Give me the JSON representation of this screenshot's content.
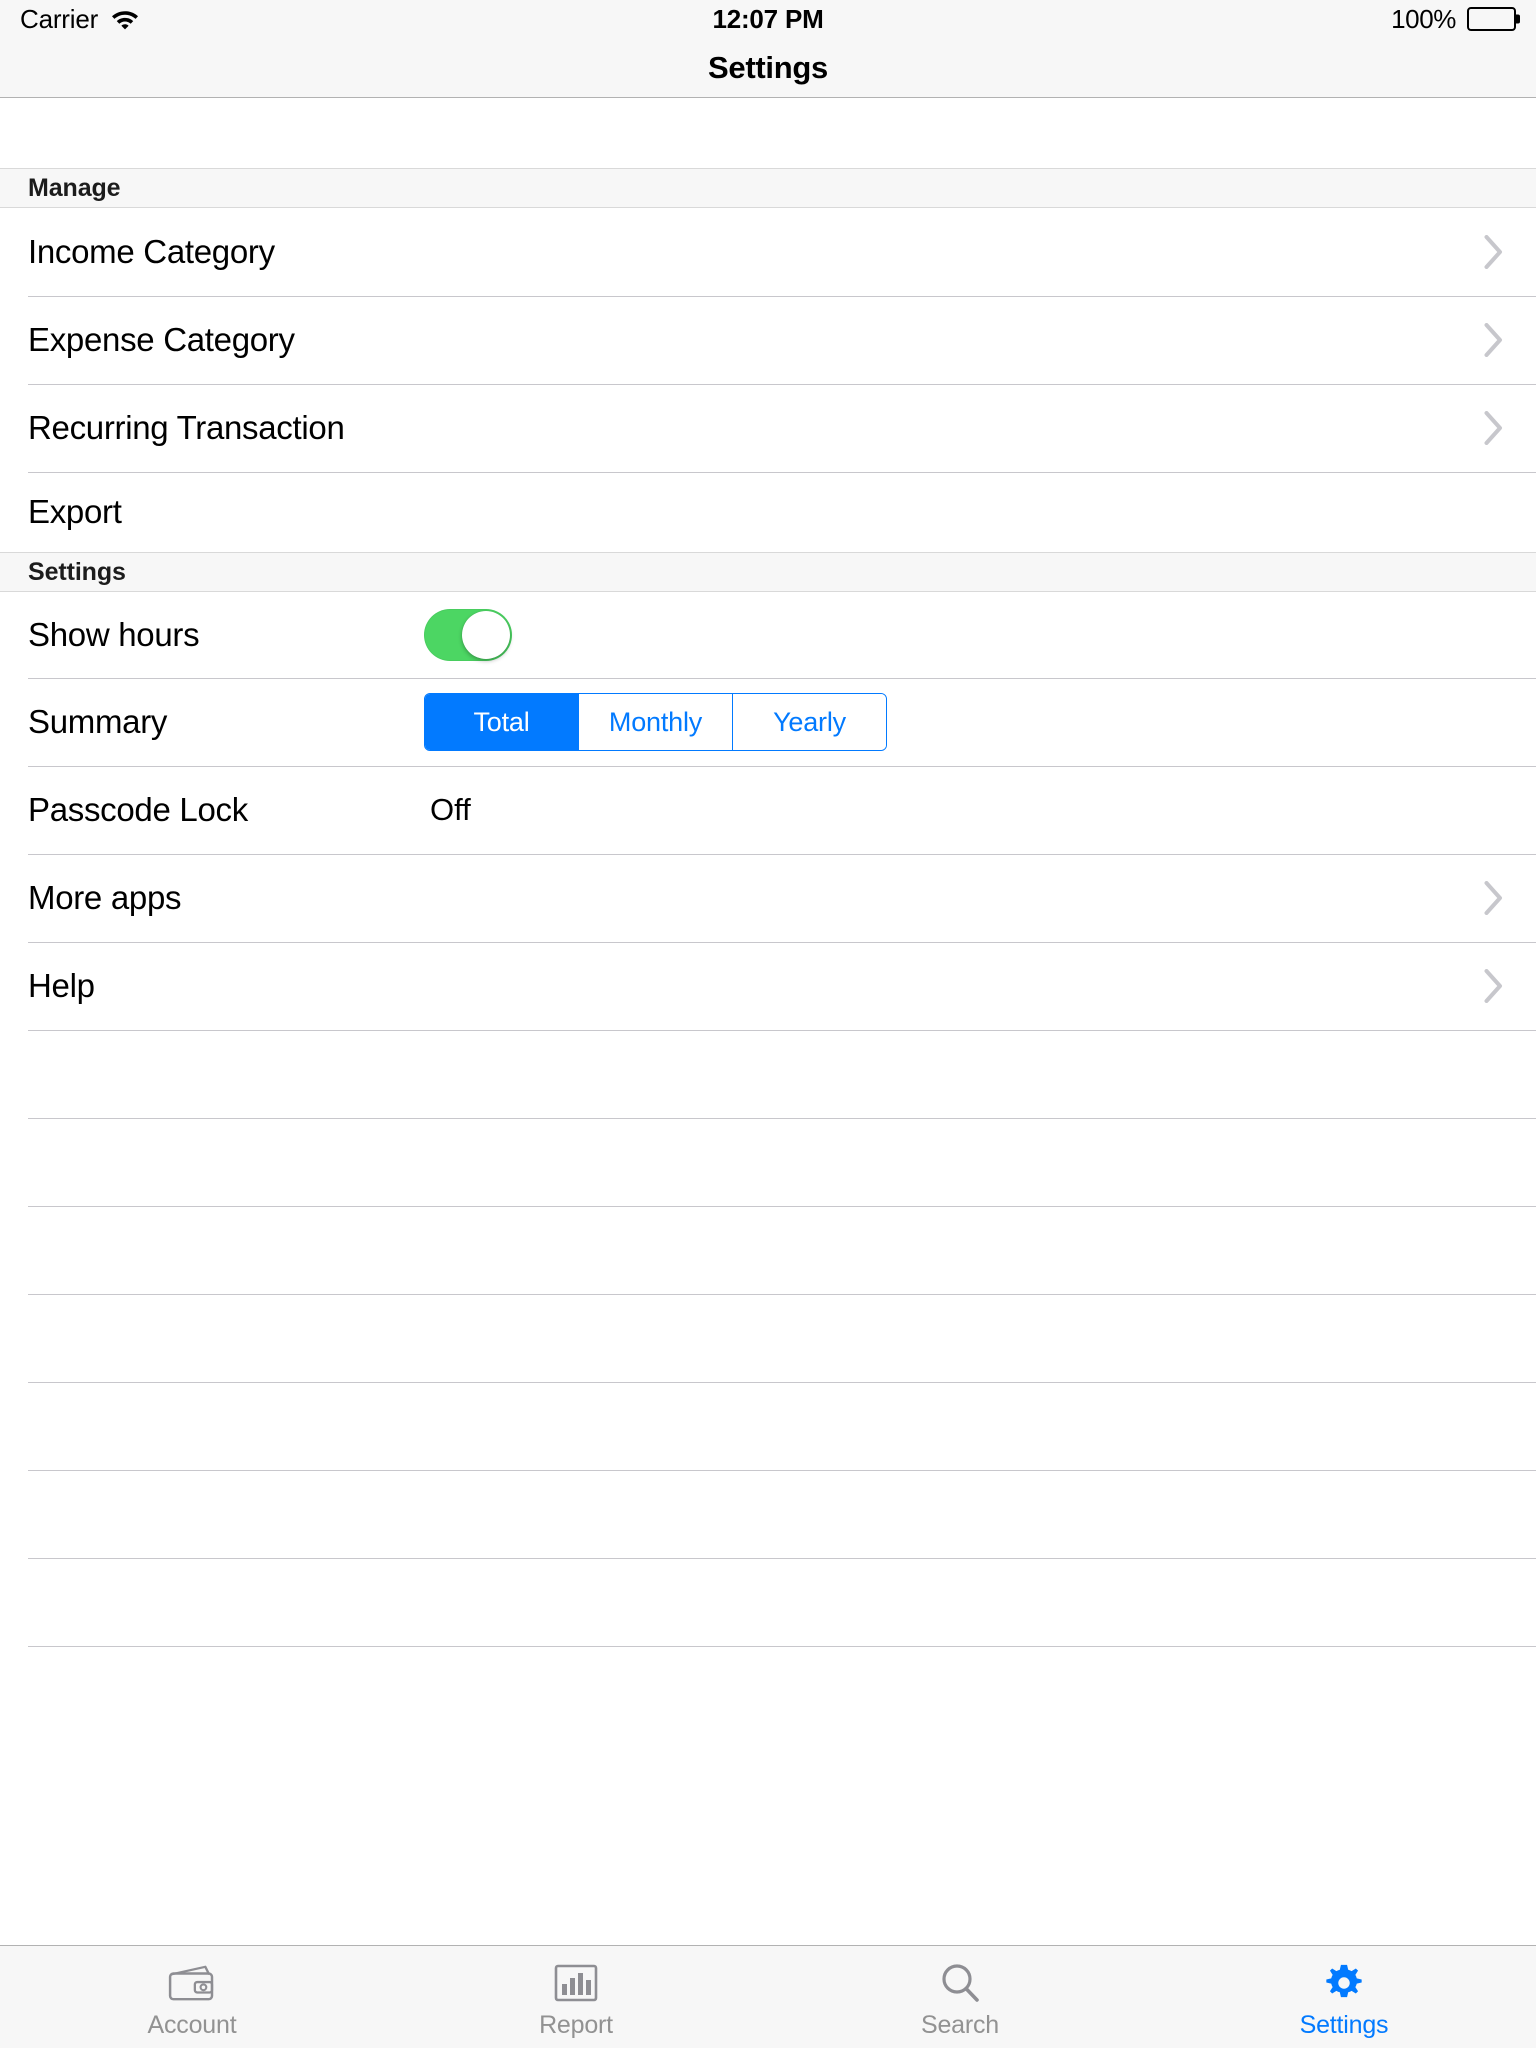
{
  "status_bar": {
    "carrier": "Carrier",
    "wifi_icon": "wifi-icon",
    "time": "12:07 PM",
    "battery_percent": "100%",
    "battery_icon": "battery-full-icon"
  },
  "nav": {
    "title": "Settings"
  },
  "colors": {
    "accent_blue": "#027aff",
    "toggle_green": "#4cd663",
    "separator": "#c8c7cc",
    "header_bg": "#f7f7f7",
    "inactive_tab": "#929292"
  },
  "sections": [
    {
      "header": "Manage",
      "rows": [
        {
          "label": "Income Category",
          "type": "disclosure",
          "accessory": "chevron-right-icon"
        },
        {
          "label": "Expense Category",
          "type": "disclosure",
          "accessory": "chevron-right-icon"
        },
        {
          "label": "Recurring Transaction",
          "type": "disclosure",
          "accessory": "chevron-right-icon"
        },
        {
          "label": "Export",
          "type": "plain",
          "accessory": ""
        }
      ]
    },
    {
      "header": "Settings",
      "rows": [
        {
          "label": "Show hours",
          "type": "switch",
          "switch_on": true
        },
        {
          "label": "Summary",
          "type": "segmented",
          "options": [
            "Total",
            "Monthly",
            "Yearly"
          ],
          "selected_index": 0,
          "selected": "Total"
        },
        {
          "label": "Passcode Lock",
          "type": "value",
          "value": "Off"
        },
        {
          "label": "More apps",
          "type": "disclosure",
          "accessory": "chevron-right-icon"
        },
        {
          "label": "Help",
          "type": "disclosure",
          "accessory": "chevron-right-icon"
        }
      ]
    }
  ],
  "empty_rows_count": 8,
  "tabbar": {
    "tabs": [
      {
        "label": "Account",
        "icon": "wallet-icon",
        "active": false
      },
      {
        "label": "Report",
        "icon": "bar-chart-icon",
        "active": false
      },
      {
        "label": "Search",
        "icon": "magnifier-icon",
        "active": false
      },
      {
        "label": "Settings",
        "icon": "gear-icon",
        "active": true
      }
    ]
  }
}
